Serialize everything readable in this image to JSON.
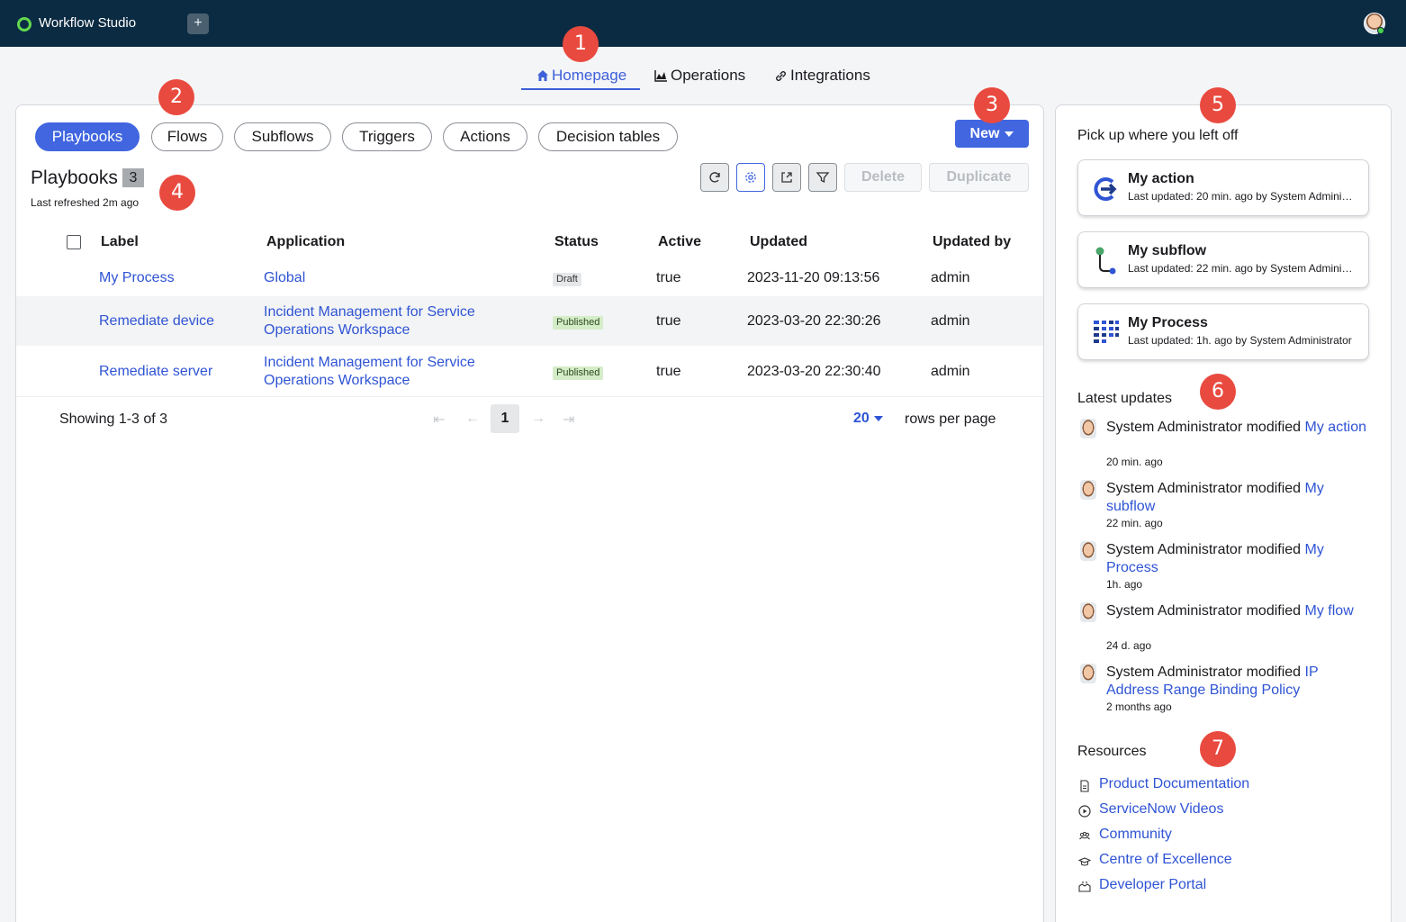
{
  "app": {
    "title": "Workflow Studio",
    "add_tab": "+"
  },
  "callouts": [
    "1",
    "2",
    "3",
    "4",
    "5",
    "6",
    "7"
  ],
  "nav": [
    {
      "label": "Homepage",
      "icon": "home-icon"
    },
    {
      "label": "Operations",
      "icon": "chart-icon"
    },
    {
      "label": "Integrations",
      "icon": "link-icon"
    }
  ],
  "tabs": [
    "Playbooks",
    "Flows",
    "Subflows",
    "Triggers",
    "Actions",
    "Decision tables"
  ],
  "new_button": "New",
  "list": {
    "title": "Playbooks",
    "count": "3",
    "refreshed": "Last refreshed 2m ago",
    "delete_label": "Delete",
    "duplicate_label": "Duplicate"
  },
  "table": {
    "columns": [
      "Label",
      "Application",
      "Status",
      "Active",
      "Updated",
      "Updated by"
    ],
    "rows": [
      {
        "label": "My Process",
        "application": "Global",
        "status": "Draft",
        "active": "true",
        "updated": "2023-11-20 09:13:56",
        "updated_by": "admin"
      },
      {
        "label": "Remediate device",
        "application": "Incident Management for Service Operations Workspace",
        "status": "Published",
        "active": "true",
        "updated": "2023-03-20 22:30:26",
        "updated_by": "admin"
      },
      {
        "label": "Remediate server",
        "application": "Incident Management for Service Operations Workspace",
        "status": "Published",
        "active": "true",
        "updated": "2023-03-20 22:30:40",
        "updated_by": "admin"
      }
    ],
    "showing": "Showing 1-3 of 3",
    "page": "1",
    "rows_per_page_value": "20",
    "rows_per_page_label": "rows per page"
  },
  "side": {
    "pickup_heading": "Pick up where you left off",
    "recent": [
      {
        "title": "My action",
        "sub": "Last updated: 20 min. ago by System Administrator",
        "icon": "action-icon"
      },
      {
        "title": "My subflow",
        "sub": "Last updated: 22 min. ago by System Administrator",
        "icon": "subflow-icon"
      },
      {
        "title": "My Process",
        "sub": "Last updated: 1h. ago by System Administrator",
        "icon": "process-icon"
      }
    ],
    "updates_heading": "Latest updates",
    "updates": [
      {
        "actor": "System Administrator modified",
        "target": "My action",
        "time": "20 min. ago"
      },
      {
        "actor": "System Administrator modified",
        "target": "My subflow",
        "time": "22 min. ago"
      },
      {
        "actor": "System Administrator modified",
        "target": "My Process",
        "time": "1h. ago"
      },
      {
        "actor": "System Administrator modified",
        "target": "My flow",
        "time": "24 d. ago"
      },
      {
        "actor": "System Administrator modified",
        "target": "IP Address Range Binding Policy",
        "time": "2 months ago"
      }
    ],
    "resources_heading": "Resources",
    "resources": [
      {
        "label": "Product Documentation",
        "icon": "document-icon"
      },
      {
        "label": "ServiceNow Videos",
        "icon": "play-icon"
      },
      {
        "label": "Community",
        "icon": "people-icon"
      },
      {
        "label": "Centre of Excellence",
        "icon": "graduation-cap-icon"
      },
      {
        "label": "Developer Portal",
        "icon": "developer-icon"
      }
    ]
  },
  "colors": {
    "topbar": "#0b2b42",
    "accent": "#4166e0",
    "link": "#2f54d4",
    "callout": "#e94a3f"
  }
}
